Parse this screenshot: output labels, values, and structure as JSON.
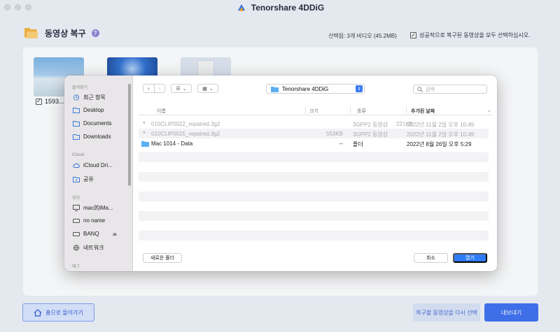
{
  "app": {
    "title": "Tenorshare 4DDiG",
    "logo_icon": "tenorshare-logo-icon"
  },
  "header": {
    "section_title": "동영상 복구",
    "help_icon": "question",
    "selected_info": "선택됨: 3개 비디오 (45.2MB)",
    "select_all_label": "성공적으로 복구된 동영상을 모두 선택하십시오.",
    "select_all_checked": true
  },
  "thumbnails": [
    {
      "label": "1593...",
      "checked": true
    },
    {
      "label": ""
    },
    {
      "label": ""
    }
  ],
  "footer": {
    "home_label": "홈으로 돌아가기",
    "reselect_label": "복구할 동영상을 다시 선택",
    "export_label": "내보내기"
  },
  "dialog": {
    "sidebar": {
      "favorites_header": "즐겨찾기",
      "favorites": [
        "최근 항목",
        "Desktop",
        "Documents",
        "Downloads"
      ],
      "icloud_header": "iCloud",
      "icloud": [
        "iCloud Dri...",
        "공유"
      ],
      "locations_header": "위치",
      "locations": [
        "mac的iMa...",
        "no name",
        "BANQ",
        "네트워크"
      ],
      "tags_header": "태그"
    },
    "toolbar": {
      "back": "‹",
      "forward": "›",
      "list_view": "☰",
      "grid_view": "▦",
      "location": "Tenorshare 4DDiG",
      "search_placeholder": "검색"
    },
    "columns": {
      "name": "이름",
      "size": "크기",
      "kind": "종류",
      "date_added": "추가된 날짜"
    },
    "files": [
      {
        "name": "010CLIP0022_repaired.3g2",
        "size": "221KB",
        "kind": "3GPP2 동영상",
        "date": "2022년 11월 2일 오후 10:49",
        "enabled": false
      },
      {
        "name": "010CLIP0015_repaired.3g2",
        "size": "553KB",
        "kind": "3GPP2 동영상",
        "date": "2022년 11월 2일 오후 10:49",
        "enabled": false
      },
      {
        "name": "Mac 1014 - Data",
        "size": "--",
        "kind": "폴더",
        "date": "2022년 8월 26일 오후 5:29",
        "enabled": true
      }
    ],
    "buttons": {
      "new_folder": "새로운 폴더",
      "cancel": "취소",
      "open": "열기"
    }
  },
  "colors": {
    "accent": "#3a6df0",
    "open_button": "#2f7cf6",
    "background": "#eef2f9"
  }
}
